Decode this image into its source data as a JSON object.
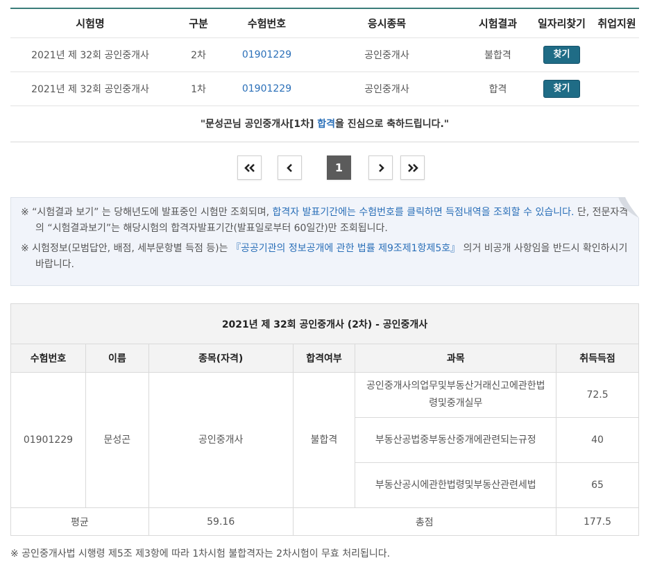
{
  "results": {
    "headers": {
      "name": "시험명",
      "type": "구분",
      "number": "수험번호",
      "subject": "응시종목",
      "result": "시험결과",
      "job": "일자리찾기",
      "employ": "취업지원"
    },
    "rows": [
      {
        "name": "2021년 제 32회 공인중개사",
        "type": "2차",
        "number": "01901229",
        "subject": "공인중개사",
        "result": "불합격",
        "button": "찾기"
      },
      {
        "name": "2021년 제 32회 공인중개사",
        "type": "1차",
        "number": "01901229",
        "subject": "공인중개사",
        "result": "합격",
        "button": "찾기"
      }
    ],
    "congrats": {
      "prefix": "\"문성곤님 공인중개사[1차] ",
      "highlight": "합격",
      "suffix": "을 진심으로 축하드립니다.\""
    }
  },
  "pager": {
    "first_icon": "double-chevron-left-icon",
    "prev_icon": "chevron-left-icon",
    "current": "1",
    "next_icon": "chevron-right-icon",
    "last_icon": "double-chevron-right-icon"
  },
  "notice": {
    "line1_a": "※ “시험결과 보기” 는 당해년도에 발표중인 시험만 조회되며, ",
    "line1_link": "합격자 발표기간에는 수험번호를 클릭하면 득점내역을 조회할 수 있습니다.",
    "line1_b": " 단, 전문자격의 “시험결과보기”는 해당시험의 합격자발표기간(발표일로부터 60일간)만 조회됩니다.",
    "line2_a": "※ 시험정보(모범답안, 배점, 세부문항별 득점 등)는 ",
    "line2_link": "『공공기관의 정보공개에 관한 법률 제9조제1항제5호』",
    "line2_b": " 의거 비공개 사항임을 반드시 확인하시기 바랍니다."
  },
  "score": {
    "title": "2021년 제 32회 공인중개사 (2차) - 공인중개사",
    "headers": {
      "number": "수험번호",
      "name": "이름",
      "category": "종목(자격)",
      "pass": "합격여부",
      "subject": "과목",
      "points": "취득득점"
    },
    "number": "01901229",
    "name": "문성곤",
    "category": "공인중개사",
    "pass": "불합격",
    "subjects": [
      {
        "name": "공인중개사의업무및부동산거래신고에관한법령및중개실무",
        "score": "72.5"
      },
      {
        "name": "부동산공법중부동산중개에관련되는규정",
        "score": "40"
      },
      {
        "name": "부동산공시에관한법령및부동산관련세법",
        "score": "65"
      }
    ],
    "avg_label": "평균",
    "avg_value": "59.16",
    "total_label": "총점",
    "total_value": "177.5"
  },
  "footnote": "※ 공인중개사법 시행령 제5조 제3항에 따라 1차시험 불합격자는 2차시험이 무효 처리됩니다."
}
